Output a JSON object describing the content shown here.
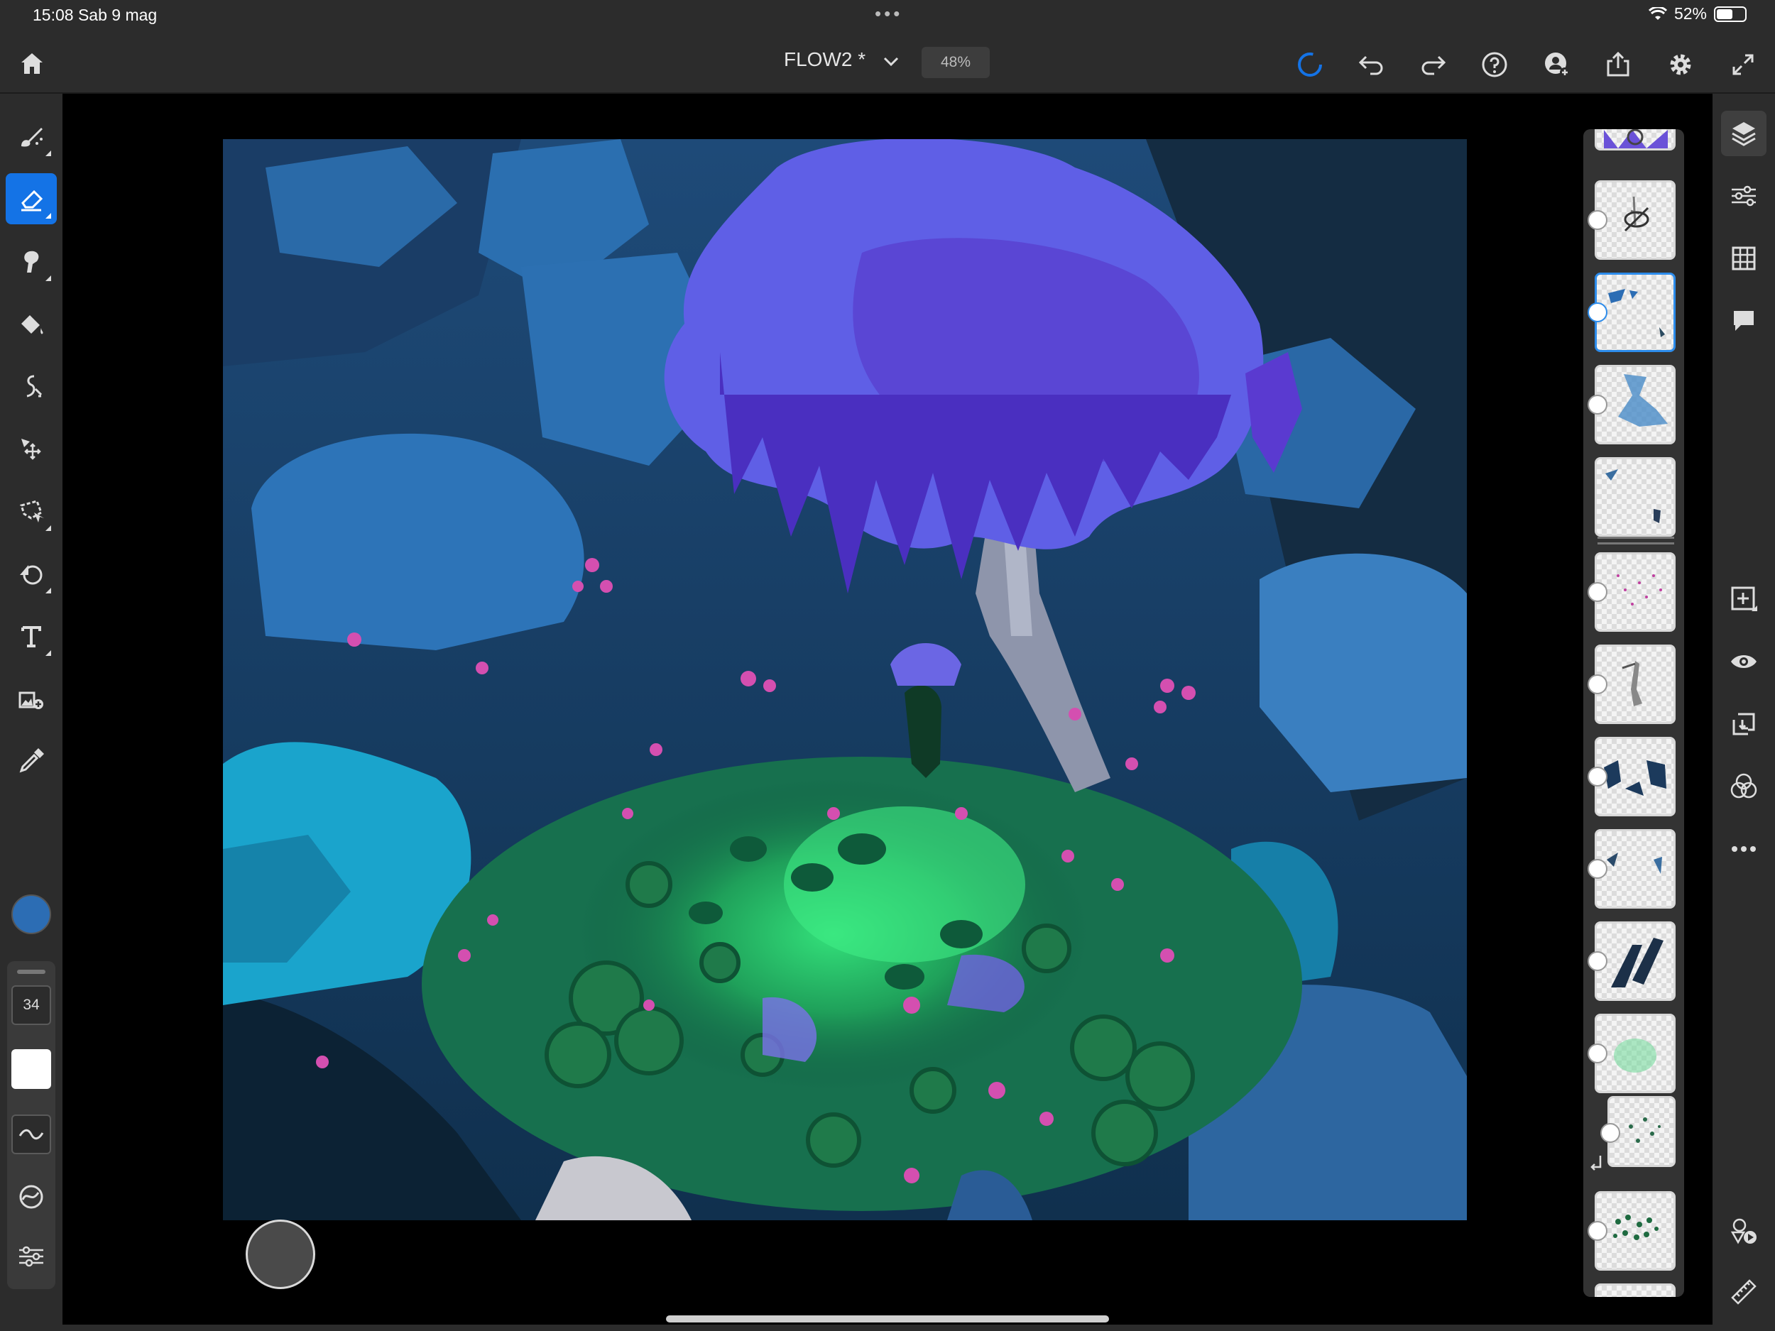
{
  "status_bar": {
    "time": "15:08 Sab 9 mag",
    "battery": "52%",
    "battery_level": 0.52,
    "more_dots": "•••"
  },
  "document": {
    "title": "FLOW2 *",
    "zoom": "48%"
  },
  "brush": {
    "size": "34",
    "color": "#2c6db4"
  },
  "accent": "#1473e6",
  "left_tools": [
    {
      "name": "brush-tool-icon",
      "active": false
    },
    {
      "name": "eraser-tool-icon",
      "active": true
    },
    {
      "name": "smudge-tool-icon",
      "active": false
    },
    {
      "name": "fill-tool-icon",
      "active": false
    },
    {
      "name": "liquify-tool-icon",
      "active": false
    },
    {
      "name": "transform-tool-icon",
      "active": false
    },
    {
      "name": "lasso-select-tool-icon",
      "active": false
    },
    {
      "name": "shape-tool-icon",
      "active": false
    },
    {
      "name": "text-tool-icon",
      "active": false
    },
    {
      "name": "place-image-tool-icon",
      "active": false
    },
    {
      "name": "eyedropper-tool-icon",
      "active": false
    }
  ],
  "right_tools": [
    "layers-icon",
    "layer-properties-icon",
    "grid-icon",
    "comments-icon",
    "add-layer-icon",
    "visibility-icon",
    "merge-down-icon",
    "blend-mode-icon",
    "more-options-icon",
    "shapes-play-icon",
    "ruler-icon"
  ],
  "layers": [
    {
      "name": "layer-1",
      "selected": false
    },
    {
      "name": "layer-2",
      "selected": false
    },
    {
      "name": "layer-3",
      "selected": true
    },
    {
      "name": "layer-4",
      "selected": false
    },
    {
      "name": "layer-5",
      "selected": false
    },
    {
      "name": "layer-6",
      "selected": false
    },
    {
      "name": "layer-7",
      "selected": false
    },
    {
      "name": "layer-8",
      "selected": false
    },
    {
      "name": "layer-9",
      "selected": false
    },
    {
      "name": "layer-10",
      "selected": false
    },
    {
      "name": "layer-11",
      "selected": false
    },
    {
      "name": "layer-12",
      "selected": false
    },
    {
      "name": "layer-13",
      "selected": false
    }
  ]
}
